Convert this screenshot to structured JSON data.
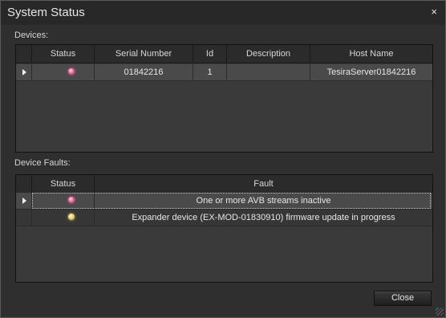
{
  "window": {
    "title": "System Status",
    "close_glyph": "×"
  },
  "devices": {
    "label": "Devices:",
    "columns": [
      "Status",
      "Serial Number",
      "Id",
      "Description",
      "Host Name"
    ],
    "rows": [
      {
        "status": "pink",
        "serial_number": "01842216",
        "id": "1",
        "description": "",
        "host_name": "TesiraServer01842216"
      }
    ]
  },
  "faults": {
    "label": "Device Faults:",
    "columns": [
      "Status",
      "Fault"
    ],
    "rows": [
      {
        "status": "pink",
        "fault": "One or more AVB streams inactive"
      },
      {
        "status": "yellow",
        "fault": "Expander device (EX-MOD-01830910) firmware update in progress"
      }
    ]
  },
  "footer": {
    "close_label": "Close"
  },
  "colors": {
    "background": "#2f2f2f",
    "status_pink": "#f06aa0",
    "status_yellow": "#e8d870"
  },
  "icons": {
    "row_indicator": "triangle-right-icon",
    "status": "led-indicator-icon",
    "resize": "resize-grip-icon"
  }
}
